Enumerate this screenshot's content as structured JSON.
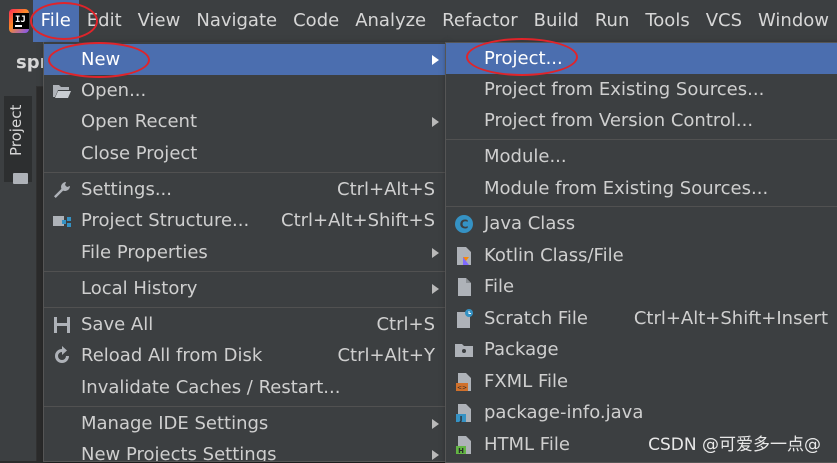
{
  "menubar": {
    "items": [
      {
        "label": "File",
        "mnemonic": "F"
      },
      {
        "label": "Edit",
        "mnemonic": "E"
      },
      {
        "label": "View",
        "mnemonic": "V"
      },
      {
        "label": "Navigate",
        "mnemonic": "N"
      },
      {
        "label": "Code",
        "mnemonic": "C"
      },
      {
        "label": "Analyze"
      },
      {
        "label": "Refactor",
        "mnemonic": "R"
      },
      {
        "label": "Build"
      },
      {
        "label": "Run",
        "mnemonic": "u"
      },
      {
        "label": "Tools",
        "mnemonic": "T"
      },
      {
        "label": "VCS"
      },
      {
        "label": "Window"
      }
    ]
  },
  "toolbar": {
    "project_name": "spr"
  },
  "sidebar": {
    "tab_label": "Project"
  },
  "file_menu": {
    "items": [
      {
        "label": "New",
        "arrow": true,
        "highlighted": true
      },
      {
        "label": "Open...",
        "icon": "open-folder-icon"
      },
      {
        "label": "Open Recent",
        "arrow": true
      },
      {
        "label": "Close Project"
      },
      {
        "label": "Settings...",
        "shortcut": "Ctrl+Alt+S",
        "icon": "wrench-icon"
      },
      {
        "label": "Project Structure...",
        "shortcut": "Ctrl+Alt+Shift+S",
        "icon": "project-structure-icon"
      },
      {
        "label": "File Properties",
        "arrow": true
      },
      {
        "label": "Local History",
        "arrow": true
      },
      {
        "label": "Save All",
        "shortcut": "Ctrl+S",
        "icon": "save-icon"
      },
      {
        "label": "Reload All from Disk",
        "shortcut": "Ctrl+Alt+Y",
        "icon": "reload-icon"
      },
      {
        "label": "Invalidate Caches / Restart..."
      },
      {
        "label": "Manage IDE Settings",
        "arrow": true
      },
      {
        "label": "New Projects Settings",
        "arrow": true
      }
    ]
  },
  "new_menu": {
    "items": [
      {
        "label": "Project...",
        "highlighted": true
      },
      {
        "label": "Project from Existing Sources..."
      },
      {
        "label": "Project from Version Control..."
      },
      {
        "label": "Module..."
      },
      {
        "label": "Module from Existing Sources..."
      },
      {
        "label": "Java Class",
        "icon": "java-class-icon"
      },
      {
        "label": "Kotlin Class/File",
        "icon": "kotlin-file-icon"
      },
      {
        "label": "File",
        "icon": "file-icon"
      },
      {
        "label": "Scratch File",
        "shortcut": "Ctrl+Alt+Shift+Insert",
        "icon": "scratch-file-icon"
      },
      {
        "label": "Package",
        "icon": "package-icon"
      },
      {
        "label": "FXML File",
        "icon": "fxml-file-icon"
      },
      {
        "label": "package-info.java",
        "icon": "package-info-icon"
      },
      {
        "label": "HTML File",
        "icon": "html-file-icon"
      }
    ]
  },
  "watermark": "CSDN @可爱多一点@",
  "colors": {
    "highlight": "#4b6eaf",
    "menu_bg": "#3c3f41",
    "annotation": "#e0242a"
  }
}
